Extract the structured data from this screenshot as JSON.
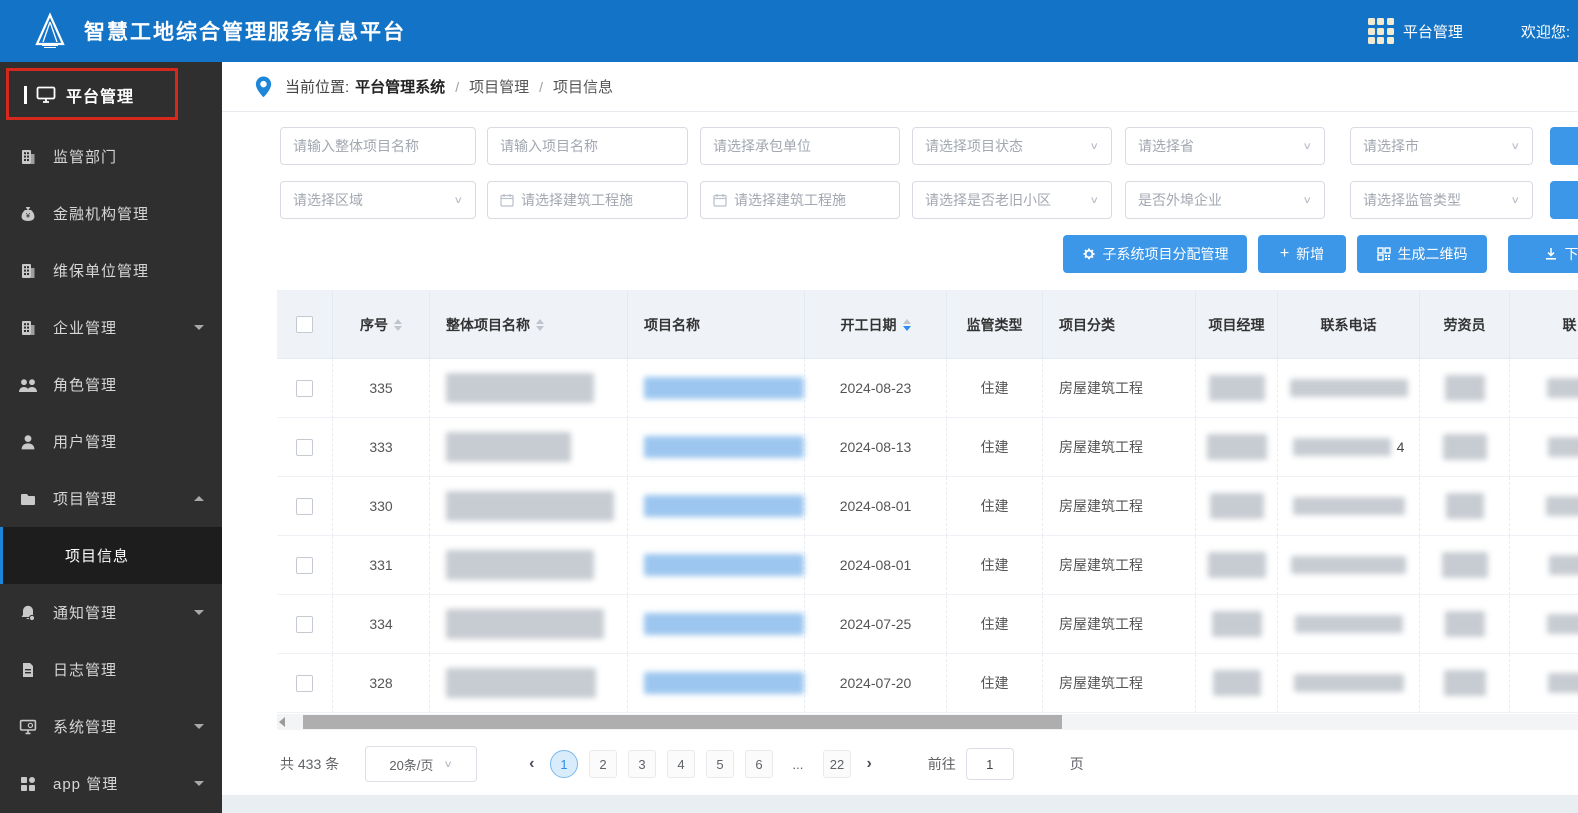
{
  "colors": {
    "header_bg": "#1373c6",
    "sidebar_bg": "#2f2f2f",
    "accent_blue": "#3d97e9",
    "link_blue": "#2d8cf0",
    "annotation_red": "#d7281d"
  },
  "header": {
    "title": "智慧工地综合管理服务信息平台",
    "platform_label": "平台管理",
    "welcome": "欢迎您:"
  },
  "sidebar": {
    "section_title": "平台管理",
    "items": [
      {
        "label": "监管部门",
        "icon": "building-icon",
        "arrow": null
      },
      {
        "label": "金融机构管理",
        "icon": "moneybag-icon",
        "arrow": null
      },
      {
        "label": "维保单位管理",
        "icon": "building-icon",
        "arrow": null
      },
      {
        "label": "企业管理",
        "icon": "building-icon",
        "arrow": "down"
      },
      {
        "label": "角色管理",
        "icon": "people-icon",
        "arrow": null
      },
      {
        "label": "用户管理",
        "icon": "user-icon",
        "arrow": null
      },
      {
        "label": "项目管理",
        "icon": "folder-icon",
        "arrow": "up",
        "expanded": true
      },
      {
        "label": "项目信息",
        "submenu": true,
        "active": true
      },
      {
        "label": "通知管理",
        "icon": "bell-icon",
        "arrow": "down"
      },
      {
        "label": "日志管理",
        "icon": "log-icon",
        "arrow": null
      },
      {
        "label": "系统管理",
        "icon": "monitor-icon",
        "arrow": "down"
      },
      {
        "label": "app 管理",
        "icon": "appgrid-icon",
        "arrow": "down"
      }
    ]
  },
  "breadcrumb": {
    "label": "当前位置:",
    "items": [
      "平台管理系统",
      "项目管理",
      "项目信息"
    ]
  },
  "filters": {
    "row1": [
      {
        "placeholder": "请输入整体项目名称",
        "type": "input"
      },
      {
        "placeholder": "请输入项目名称",
        "type": "input"
      },
      {
        "placeholder": "请选择承包单位",
        "type": "input"
      },
      {
        "placeholder": "请选择项目状态",
        "type": "select"
      },
      {
        "placeholder": "请选择省",
        "type": "select"
      },
      {
        "placeholder": "请选择市",
        "type": "select"
      }
    ],
    "row2": [
      {
        "placeholder": "请选择区域",
        "type": "select"
      },
      {
        "placeholder": "请选择建筑工程施",
        "type": "date"
      },
      {
        "placeholder": "请选择建筑工程施",
        "type": "date"
      },
      {
        "placeholder": "请选择是否老旧小区",
        "type": "select"
      },
      {
        "placeholder": "是否外埠企业",
        "type": "select"
      },
      {
        "placeholder": "请选择监管类型",
        "type": "select"
      }
    ],
    "search_button_label": ""
  },
  "actions": [
    {
      "label": "子系统项目分配管理",
      "icon": "gear-icon"
    },
    {
      "label": "新增",
      "icon": "plus-icon"
    },
    {
      "label": "生成二维码",
      "icon": "qrcode-icon"
    },
    {
      "label": "下载",
      "icon": "download-icon"
    }
  ],
  "table": {
    "columns": [
      "序号",
      "整体项目名称",
      "项目名称",
      "开工日期",
      "监管类型",
      "项目分类",
      "项目经理",
      "联系电话",
      "劳资员",
      "联"
    ],
    "sorted_column": "开工日期",
    "redacted_columns": [
      "整体项目名称",
      "项目名称",
      "项目经理",
      "联系电话",
      "劳资员",
      "联"
    ],
    "rows": [
      {
        "seq": "335",
        "start_date": "2024-08-23",
        "supervision": "住建",
        "category": "房屋建筑工程",
        "phone_visible": ""
      },
      {
        "seq": "333",
        "start_date": "2024-08-13",
        "supervision": "住建",
        "category": "房屋建筑工程",
        "phone_visible": "4"
      },
      {
        "seq": "330",
        "start_date": "2024-08-01",
        "supervision": "住建",
        "category": "房屋建筑工程",
        "phone_visible": ""
      },
      {
        "seq": "331",
        "start_date": "2024-08-01",
        "supervision": "住建",
        "category": "房屋建筑工程",
        "phone_visible": ""
      },
      {
        "seq": "334",
        "start_date": "2024-07-25",
        "supervision": "住建",
        "category": "房屋建筑工程",
        "phone_visible": ""
      },
      {
        "seq": "328",
        "start_date": "2024-07-20",
        "supervision": "住建",
        "category": "房屋建筑工程",
        "phone_visible": ""
      }
    ]
  },
  "pagination": {
    "total": "共 433 条",
    "page_size": "20条/页",
    "prev": "‹",
    "next": "›",
    "pages": [
      "1",
      "2",
      "3",
      "4",
      "5",
      "6",
      "...",
      "22"
    ],
    "active_page": "1",
    "goto_label": "前往",
    "goto_value": "1",
    "goto_suffix": "页"
  }
}
